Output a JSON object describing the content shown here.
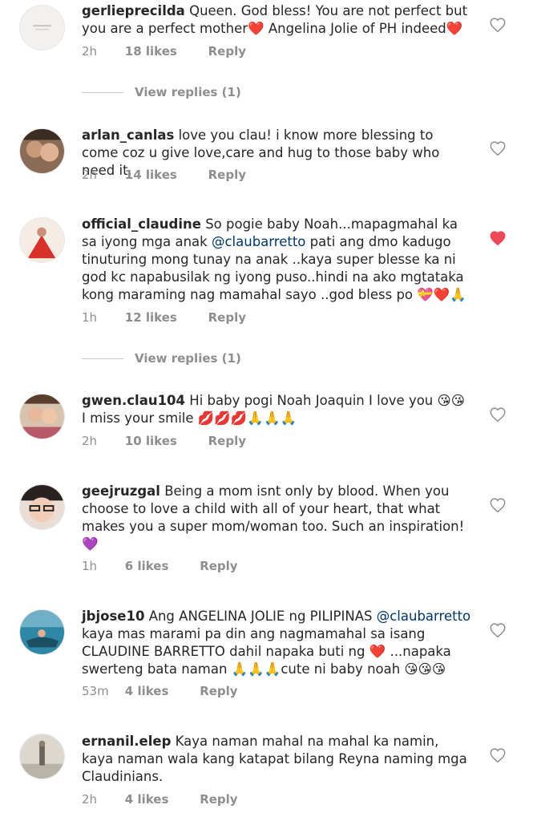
{
  "colors": {
    "liked_heart": "#ed4956",
    "unliked_heart": "#8e8e8e",
    "mention": "#003569",
    "meta": "#8e8e8e"
  },
  "comments": [
    {
      "username": "gerlieprecilda",
      "text": "Queen. God bless! You are not perfect but you are a perfect mother❤️ Angelina Jolie of PH indeed❤️",
      "time": "2h",
      "likes": "18 likes",
      "reply": "Reply",
      "liked": false,
      "view_replies": "View replies (1)"
    },
    {
      "username": "arlan_canlas",
      "text": "love you clau! i know more blessing to come coz u give love,care and hug to those baby who need it.",
      "time": "2h",
      "likes": "14 likes",
      "reply": "Reply",
      "liked": false
    },
    {
      "username": "official_claudine",
      "text_before": "So pogie baby Noah...mapagmahal ka sa iyong mga anak ",
      "mention": "@claubarretto",
      "text_after": " pati ang dmo kadugo tinuturing mong tunay na anak ..kaya super blesse ka ni god kc napabusilak ng iyong puso..hindi na ako mgtataka kong maraming nag mamahal sayo ..god bless po 💝❤️🙏",
      "time": "1h",
      "likes": "12 likes",
      "reply": "Reply",
      "liked": true,
      "view_replies": "View replies (1)"
    },
    {
      "username": "gwen.clau104",
      "text": "Hi baby pogi Noah Joaquin I love you 😘😘 I miss your smile 💋💋💋🙏🙏🙏",
      "time": "2h",
      "likes": "10 likes",
      "reply": "Reply",
      "liked": false
    },
    {
      "username": "geejruzgal",
      "text": "Being a mom isnt only by blood. When you choose to love a child with all of your heart, that what makes you a super mom/woman too. Such an inspiration! 💜",
      "time": "1h",
      "likes": "6 likes",
      "reply": "Reply",
      "liked": false
    },
    {
      "username": "jbjose10",
      "text_before": "Ang ANGELINA JOLIE ng PILIPINAS ",
      "mention": "@claubarretto",
      "text_after": " kaya mas marami pa din ang nagmamahal sa isang CLAUDINE BARRETTO dahil napaka buti ng ❤️ ...napaka swerteng bata naman 🙏🙏🙏cute ni baby noah 😘😘😘",
      "time": "53m",
      "likes": "4 likes",
      "reply": "Reply",
      "liked": false
    },
    {
      "username": "ernanil.elep",
      "text": "Kaya naman mahal na mahal ka namin,  kaya naman wala kang katapat bilang Reyna naming mga Claudinians.",
      "time": "2h",
      "likes": "4 likes",
      "reply": "Reply",
      "liked": false
    }
  ]
}
